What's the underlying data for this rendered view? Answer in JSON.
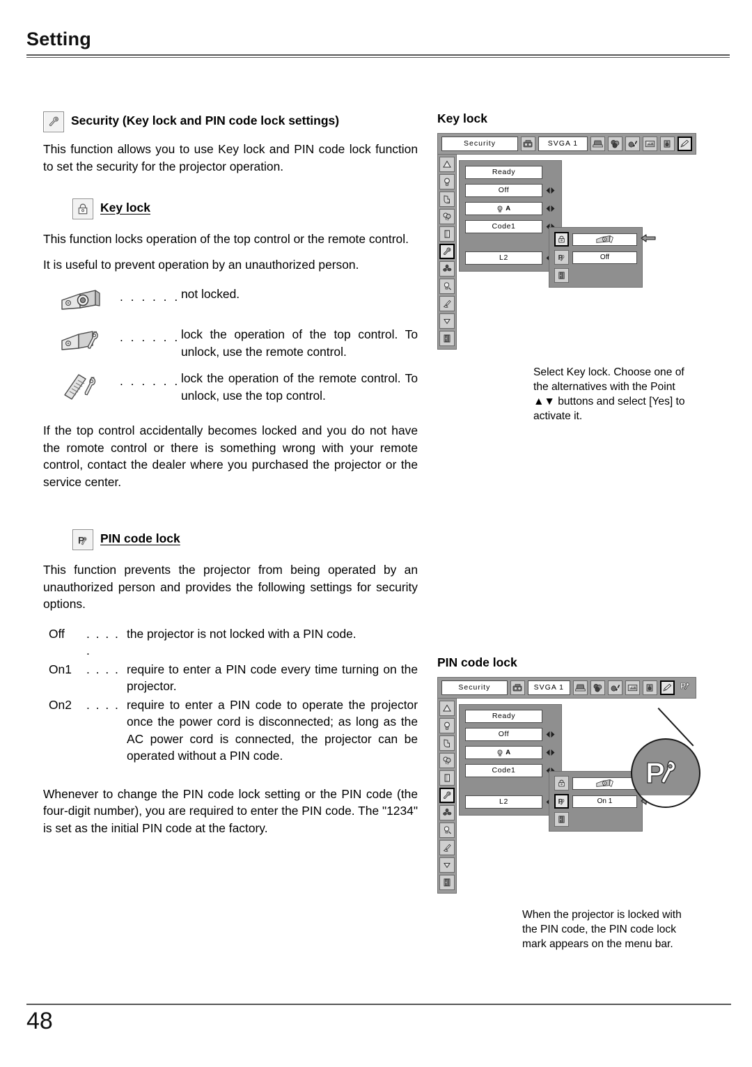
{
  "page": {
    "chapter_title": "Setting",
    "page_number": "48"
  },
  "left_column": {
    "security_heading": "Security (Key lock and PIN code lock settings)",
    "security_icon": "key-icon",
    "security_intro": "This function allows you to use Key lock and PIN code lock function to set the security for the projector operation.",
    "keylock_heading": "Key lock",
    "keylock_icon": "padlock-icon",
    "keylock_p1": "This function locks operation of the top control or the remote control.",
    "keylock_p2": "It is useful to prevent operation by an unauthorized person.",
    "legend_dots": ". . . . . .",
    "legend": [
      {
        "icon": "projector-unlocked-icon",
        "text": "not locked.",
        "lines": [
          "not locked."
        ]
      },
      {
        "icon": "projector-key-icon",
        "text": "lock the operation of the top control.  To unlock, use the remote control.",
        "lines": [
          "lock the operation of the top",
          "control.  To unlock, use the",
          "remote control."
        ]
      },
      {
        "icon": "remote-key-icon",
        "text": "lock the operation of the remote control.  To unlock, use the top control.",
        "lines": [
          "lock the operation of the",
          "remote control.  To unlock,",
          "use the top control."
        ]
      }
    ],
    "keylock_note": "If the top control accidentally becomes locked and you do not have the romote control or there is something wrong with your remote control, contact the dealer where you purchased the projector or the service center.",
    "pin_heading": "PIN code lock",
    "pin_icon": "pin-code-lock-icon",
    "pin_intro": "This function prevents the projector from being operated by an unauthorized person and provides the following settings for security options.",
    "pin_options": [
      {
        "key": "Off",
        "dots": ". . . . .",
        "text": "the projector is not locked with a PIN code.",
        "lines": [
          "the projector is not locked with a",
          "PIN code."
        ]
      },
      {
        "key": "On1",
        "dots": ". . . .",
        "text": "require to enter a PIN code every time turning on the projector.",
        "lines": [
          "require to enter a PIN code every time",
          "turning on the projector."
        ]
      },
      {
        "key": "On2",
        "dots": ". . . .",
        "text": "require to enter a PIN code to operate the projector once the power cord is disconnected;  as long as the AC power cord is connected, the projector can be operated without a PIN code.",
        "lines": [
          "require to enter a PIN code to operate",
          "the projector once the power cord",
          "is disconnected;  as long as the AC",
          "power cord is connected, the projector",
          "can be operated without a PIN code."
        ]
      }
    ],
    "pin_note": "Whenever to change the PIN code lock setting or the PIN code (the four-digit number), you are required to enter the PIN code.  The \"1234\" is set as the initial PIN code at the factory."
  },
  "right_column": {
    "keylock": {
      "caption_title": "Key lock",
      "menubar": {
        "menu_label": "Security",
        "source_icon": "video-source-icon",
        "input_label": "SVGA 1",
        "icons": [
          "computer-icon",
          "color-adjust-icon",
          "image-adjust-icon",
          "screen-icon",
          "sound-icon",
          "setting-pencil-icon"
        ],
        "selected_icon": "setting-pencil-icon",
        "pin_mark_visible": false
      },
      "sidebar_icons": [
        "keystone-icon",
        "lamp-icon",
        "pointer-icon",
        "balloon-icon",
        "book-icon",
        "security-key-icon",
        "fan-icon",
        "lamp-control-icon",
        "filter-clean-icon",
        "scroll-down-icon",
        "quit-door-icon"
      ],
      "sidebar_selected": "security-key-icon",
      "menu_items": [
        {
          "value": "Ready",
          "arrows": false
        },
        {
          "value": "Off",
          "arrows": true
        },
        {
          "value": "A",
          "arrows": true,
          "icon": "lamp-small-icon"
        },
        {
          "value": "Code1",
          "arrows": true
        },
        {
          "value": "L2",
          "arrows": true
        }
      ],
      "submenu": {
        "rows": [
          {
            "icon": "padlock-icon",
            "value": "",
            "value_icon": "projector-unlocked-icon",
            "selected": true,
            "pointer": true
          },
          {
            "icon": "pin-code-lock-icon",
            "value": "Off",
            "selected": false,
            "pointer": false
          }
        ],
        "quit_icon": "quit-door-icon"
      },
      "caption": "Select Key lock.  Choose one of the alternatives with the Point ▲▼ buttons and select [Yes] to activate it."
    },
    "pincode": {
      "caption_title": "PIN code lock",
      "menubar": {
        "menu_label": "Security",
        "source_icon": "video-source-icon",
        "input_label": "SVGA 1",
        "icons": [
          "computer-icon",
          "color-adjust-icon",
          "image-adjust-icon",
          "screen-icon",
          "sound-icon",
          "setting-pencil-icon"
        ],
        "selected_icon": "setting-pencil-icon",
        "pin_mark_visible": true,
        "pin_mark_icon": "pin-code-lock-mark-icon"
      },
      "sidebar_icons": [
        "keystone-icon",
        "lamp-icon",
        "pointer-icon",
        "balloon-icon",
        "book-icon",
        "security-key-icon",
        "fan-icon",
        "lamp-control-icon",
        "filter-clean-icon",
        "scroll-down-icon",
        "quit-door-icon"
      ],
      "sidebar_selected": "security-key-icon",
      "menu_items": [
        {
          "value": "Ready",
          "arrows": false
        },
        {
          "value": "Off",
          "arrows": true
        },
        {
          "value": "A",
          "arrows": true,
          "icon": "lamp-small-icon"
        },
        {
          "value": "Code1",
          "arrows": true
        },
        {
          "value": "L2",
          "arrows": true
        }
      ],
      "submenu": {
        "rows": [
          {
            "icon": "padlock-icon",
            "value": "",
            "value_icon": "projector-unlocked-icon",
            "selected": false,
            "pointer": false
          },
          {
            "icon": "pin-code-lock-icon",
            "value": "On 1",
            "selected": true,
            "pointer": true
          }
        ],
        "quit_icon": "quit-door-icon"
      },
      "magnifier_icon": "pin-code-lock-mark-icon",
      "caption": "When the projector is locked with the PIN code, the PIN code lock mark appears on the menu bar."
    }
  }
}
